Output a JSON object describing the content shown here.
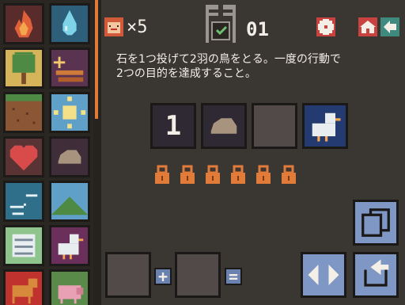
{
  "header": {
    "lives_symbol": "×5",
    "level_number": "01"
  },
  "instruction": {
    "text": "石を1つ投げて2羽の鳥をとる。一度の行動で\n2つの目的を達成すること。"
  },
  "sequence": {
    "slot1": "1"
  },
  "bottom": {
    "plus": "+",
    "equals": "="
  },
  "colors": {
    "accent_orange": "#e07b39",
    "home_red": "#c8423f",
    "back_teal": "#3f8a7e",
    "blue_panel": "#7f97c4"
  },
  "palette_icons": [
    "fire-icon",
    "water-icon",
    "tree-icon",
    "wood-icon",
    "earth-icon",
    "sun-icon",
    "heart-icon",
    "stone-icon",
    "wind-icon",
    "mountain-icon",
    "scroll-icon",
    "bird-icon",
    "dog-icon",
    "pig-icon"
  ]
}
